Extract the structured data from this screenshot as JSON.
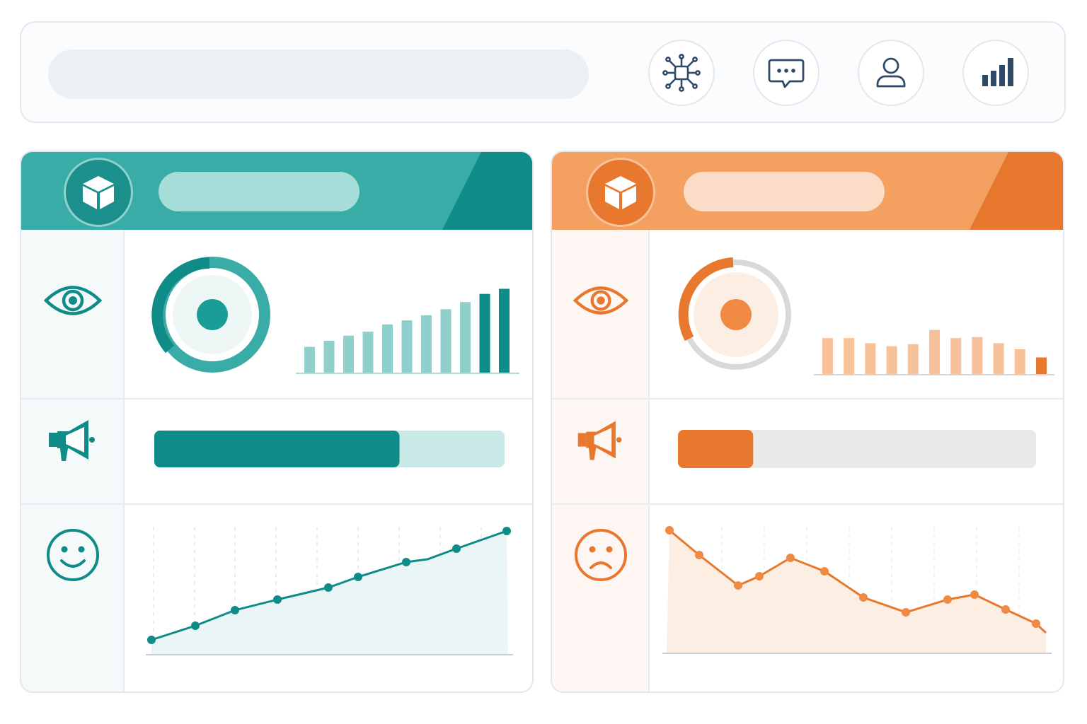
{
  "search": {
    "placeholder": "",
    "value": ""
  },
  "toolbar": {
    "buttons": [
      {
        "icon": "network-chip-icon"
      },
      {
        "icon": "chat-bubble-icon"
      },
      {
        "icon": "user-icon"
      },
      {
        "icon": "bar-chart-icon"
      }
    ],
    "icon_color": "#2f4a66"
  },
  "panels": [
    {
      "theme": "positive",
      "accent": "#0f8c88",
      "accent_light": "#3aaca7",
      "pill": "#a6ddd9",
      "tint": "#f4fafa",
      "rows": [
        {
          "icon": "eye-icon"
        },
        {
          "icon": "megaphone-icon"
        },
        {
          "icon": "smiley-happy-icon"
        }
      ],
      "donut_share": 0.33,
      "progress": 0.7,
      "bars": [
        0.26,
        0.32,
        0.37,
        0.41,
        0.48,
        0.52,
        0.57,
        0.63,
        0.7,
        0.78,
        0.83
      ]
    },
    {
      "theme": "negative",
      "accent": "#e8782d",
      "accent_light": "#f3a060",
      "pill": "#fbdcc6",
      "tint": "#fdf6f2",
      "rows": [
        {
          "icon": "eye-icon"
        },
        {
          "icon": "megaphone-icon"
        },
        {
          "icon": "smiley-sad-icon"
        }
      ],
      "donut_share": 0.33,
      "progress": 0.21,
      "bars": [
        0.36,
        0.36,
        0.31,
        0.28,
        0.3,
        0.44,
        0.36,
        0.37,
        0.31,
        0.25,
        0.17
      ]
    }
  ]
}
